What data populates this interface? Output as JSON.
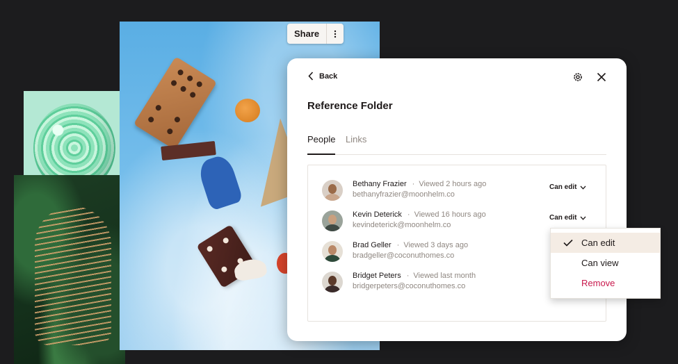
{
  "toolbar": {
    "share_label": "Share",
    "more_icon": "more-vertical-icon"
  },
  "panel": {
    "back_label": "Back",
    "title": "Reference Folder",
    "tabs": [
      {
        "label": "People",
        "active": true
      },
      {
        "label": "Links",
        "active": false
      }
    ],
    "people": [
      {
        "name": "Bethany Frazier",
        "viewed": "Viewed 2 hours ago",
        "email": "bethanyfrazier@moonhelm.co",
        "permission": "Can edit"
      },
      {
        "name": "Kevin Deterick",
        "viewed": "Viewed 16 hours ago",
        "email": "kevindeterick@moonhelm.co",
        "permission": "Can edit"
      },
      {
        "name": "Brad Geller",
        "viewed": "Viewed 3 days ago",
        "email": "bradgeller@coconuthomes.co"
      },
      {
        "name": "Bridget Peters",
        "viewed": "Viewed last month",
        "email": "bridgerpeters@coconuthomes.co"
      }
    ],
    "separator": "·"
  },
  "permission_menu": {
    "options": [
      {
        "label": "Can edit",
        "selected": true
      },
      {
        "label": "Can view",
        "selected": false
      },
      {
        "label": "Remove",
        "selected": false,
        "danger": true
      }
    ]
  },
  "colors": {
    "accent": "#1e1919",
    "danger": "#c8184c",
    "selected_bg": "#f4ece4",
    "muted": "#8f8781"
  }
}
